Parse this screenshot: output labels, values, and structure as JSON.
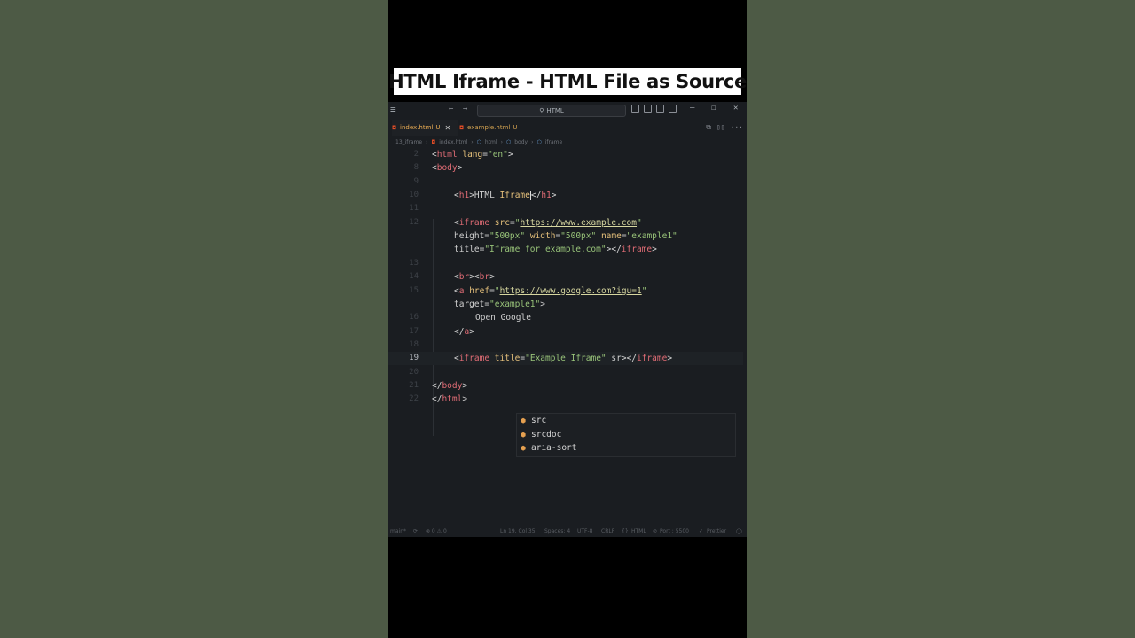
{
  "video_title": "HTML Iframe - HTML File as Source",
  "editor": {
    "search_label": "HTML",
    "tabs": [
      {
        "name": "index.html",
        "status": "U",
        "active": true
      },
      {
        "name": "example.html",
        "status": "U",
        "active": false
      }
    ],
    "breadcrumb": [
      "13_iframe",
      "index.html",
      "html",
      "body",
      "iframe"
    ],
    "code_lines": [
      {
        "num": "2",
        "text": "<html lang=\"en\">"
      },
      {
        "num": "8",
        "text": "<body>"
      },
      {
        "num": "9",
        "text": ""
      },
      {
        "num": "10",
        "text": "<h1>HTML Iframe</h1>"
      },
      {
        "num": "11",
        "text": ""
      },
      {
        "num": "12",
        "text": "<iframe src=\"https://www.example.com\""
      },
      {
        "num": "",
        "text": "height=\"500px\" width=\"500px\" name=\"example1\""
      },
      {
        "num": "",
        "text": "title=\"Iframe for example.com\"></iframe>"
      },
      {
        "num": "13",
        "text": ""
      },
      {
        "num": "14",
        "text": "<br><br>"
      },
      {
        "num": "15",
        "text": "<a href=\"https://www.google.com?igu=1\""
      },
      {
        "num": "",
        "text": "target=\"example1\">"
      },
      {
        "num": "16",
        "text": "Open Google"
      },
      {
        "num": "17",
        "text": "</a>"
      },
      {
        "num": "18",
        "text": ""
      },
      {
        "num": "19",
        "text": "<iframe title=\"Example Iframe\" sr></iframe>"
      },
      {
        "num": "20",
        "text": ""
      },
      {
        "num": "21",
        "text": "</body>"
      },
      {
        "num": "22",
        "text": "</html>"
      }
    ],
    "suggestions": [
      "src",
      "srcdoc",
      "aria-sort"
    ],
    "status_bar": {
      "branch": "main*",
      "problems": "⊗ 0 ⚠ 0",
      "cursor": "Ln 19, Col 35",
      "spaces": "Spaces: 4",
      "encoding": "UTF-8",
      "eol": "CRLF",
      "language": "HTML",
      "port": "Port : 5500",
      "formatter": "Prettier"
    }
  },
  "colors": {
    "tag": "#e06c75",
    "attr": "#e5c07b",
    "string": "#98c379",
    "editor_bg": "#1a1d21",
    "tab_accent": "#e8ab53"
  }
}
